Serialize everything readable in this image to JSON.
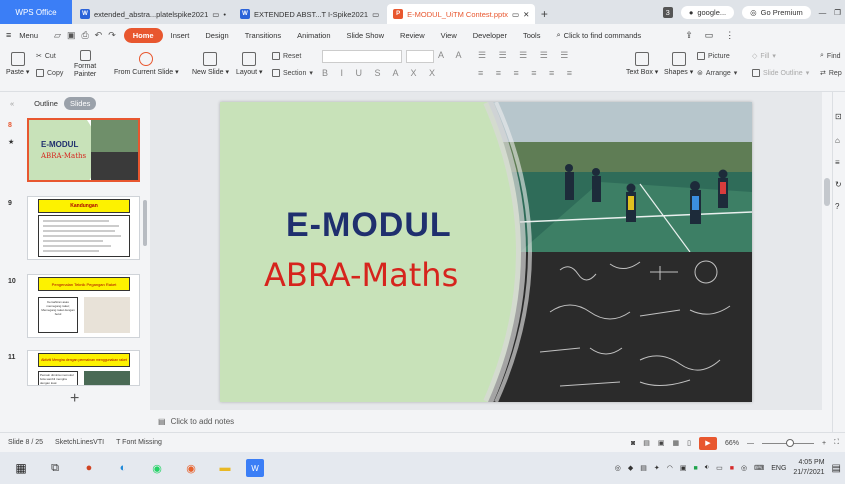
{
  "titlebar": {
    "app_name": "WPS Office",
    "tabs": [
      {
        "label": "extended_abstra...platelspike2021",
        "type": "w"
      },
      {
        "label": "EXTENDED ABST...T I-Spike2021",
        "type": "w"
      },
      {
        "label": "E-MODUL_UiTM Contest.pptx",
        "type": "p"
      }
    ],
    "new_tab": "+",
    "account_badge": "3",
    "account_label": "google...",
    "premium_label": "Go Premium"
  },
  "menubar": {
    "menu_label": "Menu",
    "items": [
      "Home",
      "Insert",
      "Design",
      "Transitions",
      "Animation",
      "Slide Show",
      "Review",
      "View",
      "Developer",
      "Tools"
    ],
    "find_placeholder": "Click to find commands"
  },
  "ribbon": {
    "paste": "Paste",
    "cut": "Cut",
    "copy": "Copy",
    "format_painter_1": "Format",
    "format_painter_2": "Painter",
    "from_current_slide": "From Current Slide",
    "new_slide": "New Slide",
    "layout": "Layout",
    "reset": "Reset",
    "section": "Section",
    "text_box": "Text Box",
    "shapes": "Shapes",
    "arrange": "Arrange",
    "picture": "Picture",
    "fill": "Fill",
    "slide_outline": "Slide Outline",
    "find": "Find",
    "replace": "Rep"
  },
  "left_panel": {
    "tab_outline": "Outline",
    "tab_slides": "Slides",
    "slides": [
      {
        "num": "8",
        "title": "E-MODUL",
        "subtitle": "ABRA-Maths"
      },
      {
        "num": "9",
        "title": "Kandungan"
      },
      {
        "num": "10",
        "title": "Pengenalan Teknik Pegangan Raket",
        "caption": "Kemahiran asas memegang raket; Memegang raket dengan betul"
      },
      {
        "num": "11",
        "title": "Aktiviti Mengira dengan permainan menggunakan raket",
        "caption": "Pemain diminta memukul bola sambil mengira dengan kuat"
      }
    ],
    "add_slide": "+"
  },
  "slide": {
    "title": "E-MODUL",
    "subtitle": "ABRA-Maths",
    "colors": {
      "green": "#c8e2b9",
      "title": "#1f2f6e",
      "subtitle": "#d6241d"
    }
  },
  "notes": {
    "placeholder": "Click to add notes"
  },
  "statusbar": {
    "slide_indicator": "Slide 8 / 25",
    "theme": "SketchLinesVTI",
    "font_missing": "Font Missing",
    "zoom": "66%"
  },
  "taskbar": {
    "language": "ENG",
    "time": "4:05 PM",
    "date": "21/7/2021"
  }
}
